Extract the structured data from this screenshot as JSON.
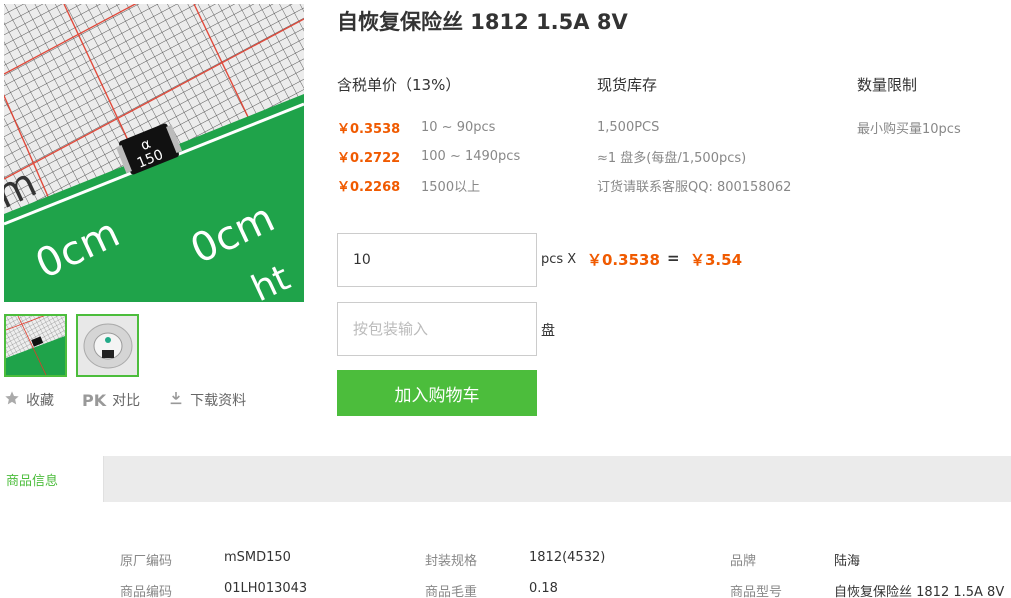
{
  "product": {
    "title": "自恢复保险丝 1812 1.5A 8V",
    "chip_mark_top": "α",
    "chip_mark_bottom": "150",
    "ruler_text": "0cm",
    "ruler_text_edge": "m",
    "ruler_text_corner": "ht"
  },
  "actions": {
    "favorite": "收藏",
    "compare_badge": "PK",
    "compare": "对比",
    "download": "下载资料"
  },
  "pricing": {
    "header": "含税单价（13%）",
    "tiers": [
      {
        "price": "￥0.3538",
        "qty": "10 ~ 90pcs"
      },
      {
        "price": "￥0.2722",
        "qty": "100 ~ 1490pcs"
      },
      {
        "price": "￥0.2268",
        "qty": "1500以上"
      }
    ]
  },
  "stock": {
    "header": "现货库存",
    "lines": [
      "1,500PCS",
      "≈1 盘多(每盘/1,500pcs)",
      "订货请联系客服QQ: 800158062"
    ]
  },
  "limit": {
    "header": "数量限制",
    "value": "最小购买量10pcs"
  },
  "order": {
    "qty_value": "10",
    "qty_unit": "pcs X",
    "unit_price": "￥0.3538",
    "equals": "=",
    "total": "￥3.54",
    "reel_placeholder": "按包装输入",
    "reel_unit": "盘",
    "add_to_cart": "加入购物车"
  },
  "tabs": {
    "info": "商品信息"
  },
  "specs": {
    "row1": [
      {
        "k": "原厂编码",
        "v": "mSMD150"
      },
      {
        "k": "封装规格",
        "v": "1812(4532)"
      },
      {
        "k": "品牌",
        "v": "陆海"
      }
    ],
    "row2": [
      {
        "k": "商品编码",
        "v": "01LH013043"
      },
      {
        "k": "商品毛重",
        "v": "0.18"
      },
      {
        "k": "商品型号",
        "v": "自恢复保险丝 1812 1.5A 8V"
      }
    ]
  },
  "colors": {
    "accent_green": "#4cbd3c",
    "price_orange": "#f05a00"
  }
}
